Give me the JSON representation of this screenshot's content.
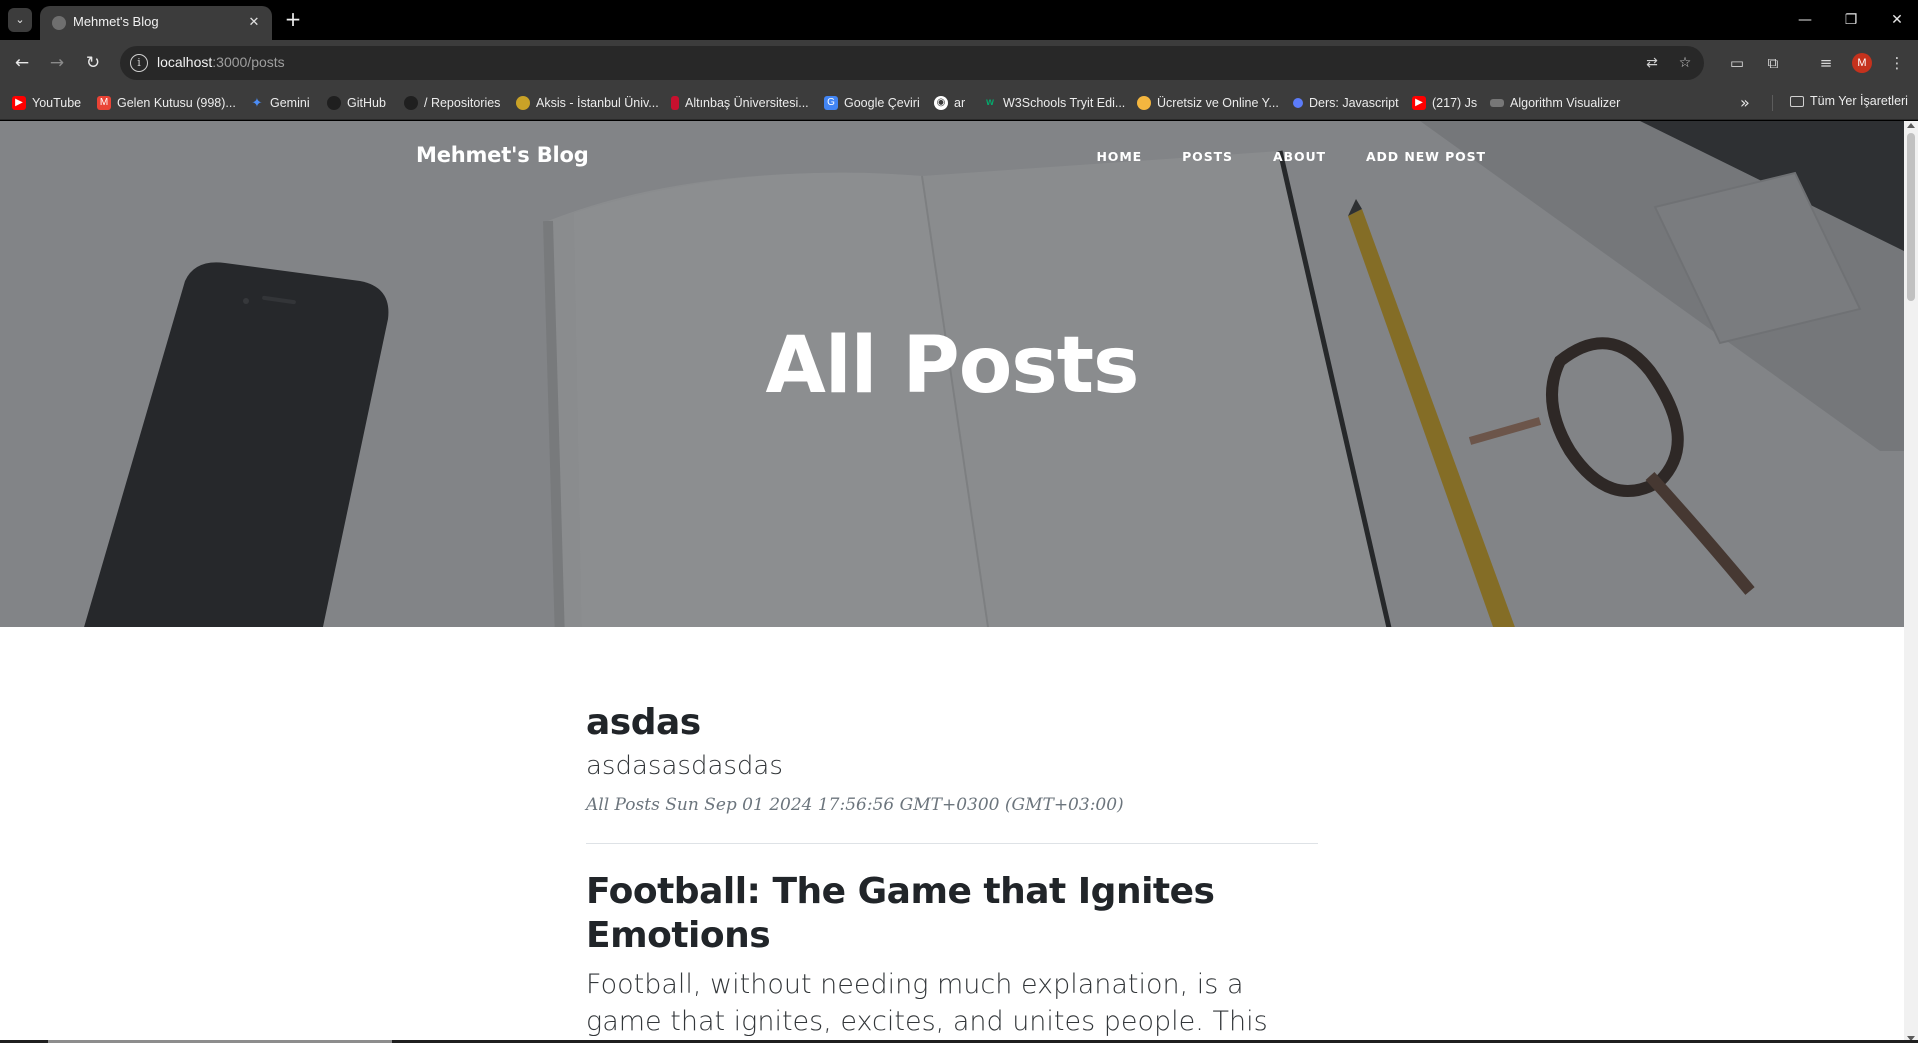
{
  "browser": {
    "tab_title": "Mehmet's Blog",
    "url_host": "localhost",
    "url_path": ":3000/posts",
    "avatar_letter": "M",
    "bookmarks": [
      {
        "label": "YouTube",
        "icon": "youtube-icon",
        "color": "#ff0000"
      },
      {
        "label": "Gelen Kutusu (998)...",
        "icon": "gmail-icon",
        "color": "#ea4335"
      },
      {
        "label": "Gemini",
        "icon": "gemini-icon",
        "color": "#4c8df6"
      },
      {
        "label": "GitHub",
        "icon": "github-icon",
        "color": "#1f1f1f"
      },
      {
        "label": "/ Repositories",
        "icon": "github-icon",
        "color": "#1f1f1f"
      },
      {
        "label": "Aksis - İstanbul Üniv...",
        "icon": "university-icon",
        "color": "#c9a227"
      },
      {
        "label": "Altınbaş Üniversitesi...",
        "icon": "university-icon",
        "color": "#c8102e"
      },
      {
        "label": "Google Çeviri",
        "icon": "translate-icon",
        "color": "#4285f4"
      },
      {
        "label": "ar",
        "icon": "globe-icon",
        "color": "#ffffff"
      },
      {
        "label": "W3Schools Tryit Edi...",
        "icon": "w3schools-icon",
        "color": "#04aa6d"
      },
      {
        "label": "Ücretsiz ve Online Y...",
        "icon": "circle-icon",
        "color": "#f4b63f"
      },
      {
        "label": "Ders: Javascript",
        "icon": "circle-icon",
        "color": "#5c7cfa"
      },
      {
        "label": "(217) Js",
        "icon": "youtube-icon",
        "color": "#ff0000"
      },
      {
        "label": "Algorithm Visualizer",
        "icon": "app-icon",
        "color": "#777777"
      }
    ],
    "all_bookmarks_label": "Tüm Yer İşaretleri"
  },
  "site": {
    "brand": "Mehmet's Blog",
    "nav": [
      "Home",
      "Posts",
      "About",
      "Add New Post"
    ],
    "hero_title": "All Posts"
  },
  "posts": [
    {
      "title": "asdas",
      "subtitle": "asdasasdasdas",
      "meta": "All Posts Sun Sep 01 2024 17:56:56 GMT+0300 (GMT+03:00)"
    },
    {
      "title": "Football: The Game that Ignites Emotions",
      "subtitle": "Football, without needing much explanation, is a game that ignites, excites, and unites people. This sport, loved"
    }
  ]
}
